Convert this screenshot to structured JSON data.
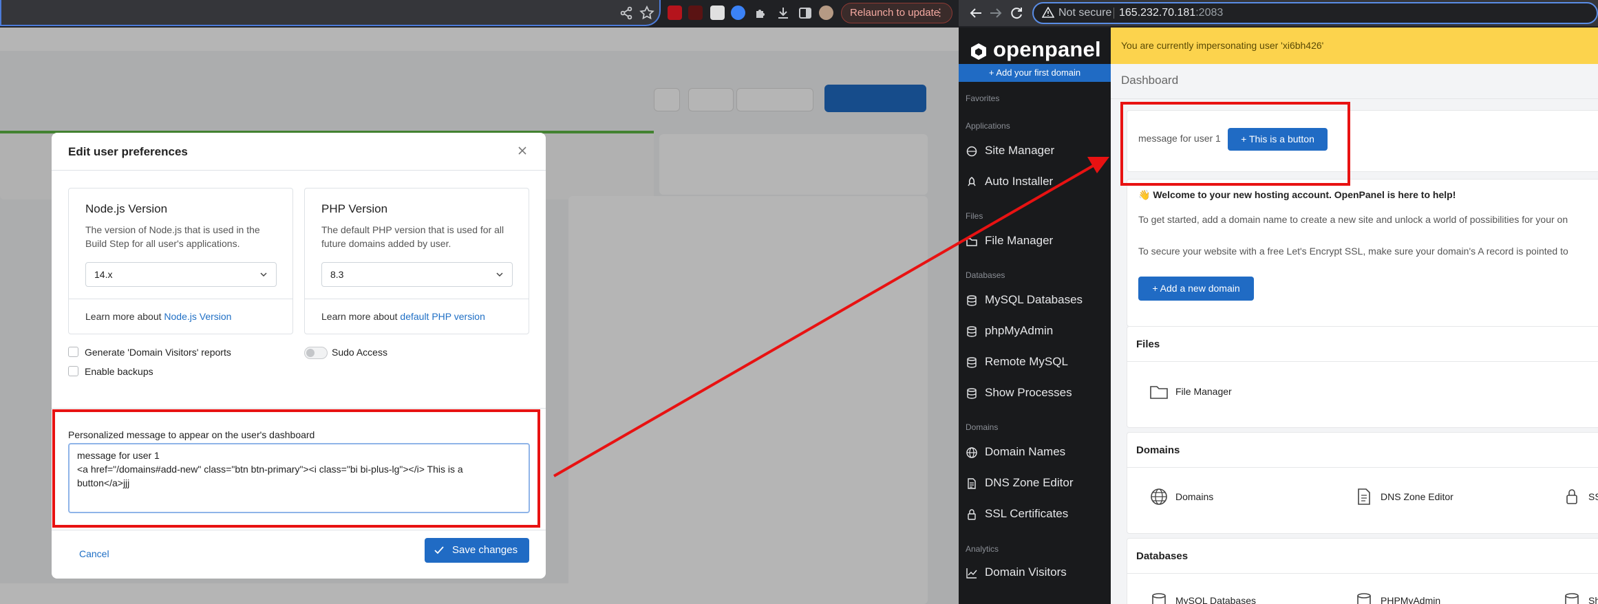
{
  "browser": {
    "relaunch_label": "Relaunch to update",
    "security_label": "Not secure",
    "url_host": "165.232.70.181",
    "url_port": ":2083"
  },
  "modal": {
    "title": "Edit user preferences",
    "node": {
      "title": "Node.js Version",
      "description": "The version of Node.js that is used in the Build Step for all user's applications.",
      "selected": "14.x",
      "learn_prefix": "Learn more about ",
      "learn_link": "Node.js Version"
    },
    "php": {
      "title": "PHP Version",
      "description": "The default PHP version that is used for all future domains added by user.",
      "selected": "8.3",
      "learn_prefix": "Learn more about ",
      "learn_link": "default PHP version"
    },
    "visitors_label": "Generate 'Domain Visitors' reports",
    "sudo_label": "Sudo Access",
    "backups_label": "Enable backups",
    "message_label": "Personalized message to appear on the user's dashboard",
    "message_value": "message for user 1\n<a href=\"/domains#add-new\" class=\"btn btn-primary\"><i class=\"bi bi-plus-lg\"></i> This is a\nbutton</a>jjj\n",
    "cancel_label": "Cancel",
    "save_label": "Save changes"
  },
  "openpanel": {
    "brand": "openpanel",
    "add_first_domain": "+ Add your first domain",
    "impersonation_banner": "You are currently impersonating user 'xi6bh426'",
    "breadcrumb": "Dashboard",
    "sidebar": {
      "sections": [
        "Favorites",
        "Applications",
        "Files",
        "Databases",
        "Domains",
        "Analytics"
      ],
      "items": [
        "Site Manager",
        "Auto Installer",
        "File Manager",
        "MySQL Databases",
        "phpMyAdmin",
        "Remote MySQL",
        "Show Processes",
        "Domain Names",
        "DNS Zone Editor",
        "SSL Certificates",
        "Domain Visitors"
      ]
    },
    "message_text": "message for user 1",
    "message_button": "This is a button",
    "welcome_title": "👋 Welcome to your new hosting account. OpenPanel is here to help!",
    "welcome_p1": "To get started, add a domain name to create a new site and unlock a world of possibilities for your on",
    "welcome_p2": "To secure your website with a free Let's Encrypt SSL, make sure your domain's A record is pointed to",
    "add_domain_button": "Add a new domain",
    "files_heading": "Files",
    "files_item": "File Manager",
    "domains_heading": "Domains",
    "domains_items": [
      "Domains",
      "DNS Zone Editor",
      "SS"
    ],
    "databases_heading": "Databases",
    "databases_items": [
      "MySQL Databases",
      "PHPMyAdmin",
      "Sh"
    ]
  },
  "colors": {
    "primary": "#206bc4",
    "annotation_red": "#e81212",
    "banner_yellow": "#fcd34d",
    "sidebar_dark": "#191a1c"
  }
}
